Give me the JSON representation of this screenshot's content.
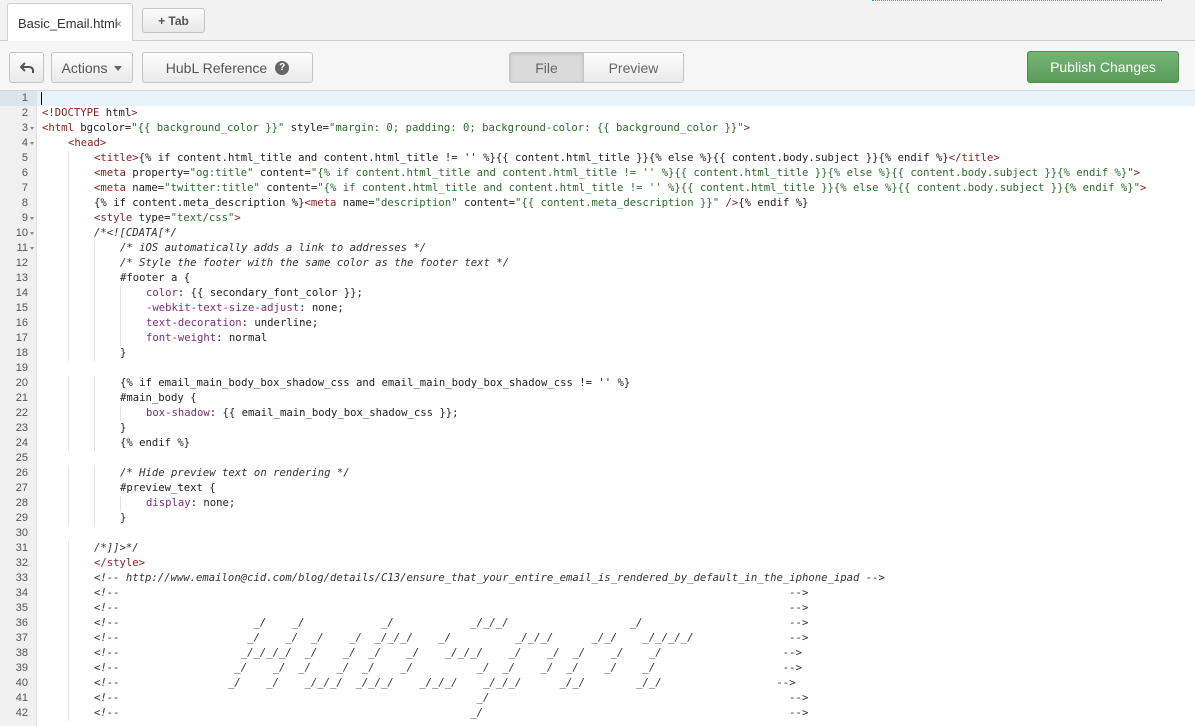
{
  "tabs": {
    "file_tab": {
      "label": "Basic_Email.html",
      "close_glyph": "×"
    },
    "add_tab_label": "+ Tab"
  },
  "toolbar": {
    "back_icon": "undo-arrow-icon",
    "actions_label": "Actions",
    "hubl_label": "HubL Reference",
    "help_glyph": "?",
    "view_modes": {
      "file_label": "File",
      "preview_label": "Preview",
      "selected": "File"
    },
    "publish_label": "Publish Changes"
  },
  "colors": {
    "tag": "#8a2121",
    "attr_name": "#222222",
    "string": "#2d6a2d",
    "comment": "#333333",
    "property": "#7a2d7a",
    "publish_green": "#5fa05f",
    "active_line": "#e8f2fb"
  },
  "editor": {
    "cursor_line": 1,
    "lines": [
      {
        "n": 1,
        "fold": false,
        "indent": 0,
        "text": ""
      },
      {
        "n": 2,
        "fold": false,
        "indent": 0,
        "text": "<!DOCTYPE html>"
      },
      {
        "n": 3,
        "fold": true,
        "indent": 0,
        "text": "<html bgcolor=\"{{ background_color }}\" style=\"margin: 0; padding: 0; background-color: {{ background_color }}\">"
      },
      {
        "n": 4,
        "fold": true,
        "indent": 1,
        "text": "<head>"
      },
      {
        "n": 5,
        "fold": false,
        "indent": 2,
        "text": "<title>{% if content.html_title and content.html_title != '' %}{{ content.html_title }}{% else %}{{ content.body.subject }}{% endif %}</title>"
      },
      {
        "n": 6,
        "fold": false,
        "indent": 2,
        "text": "<meta property=\"og:title\" content=\"{% if content.html_title and content.html_title != '' %}{{ content.html_title }}{% else %}{{ content.body.subject }}{% endif %}\">"
      },
      {
        "n": 7,
        "fold": false,
        "indent": 2,
        "text": "<meta name=\"twitter:title\" content=\"{% if content.html_title and content.html_title != '' %}{{ content.html_title }}{% else %}{{ content.body.subject }}{% endif %}\">"
      },
      {
        "n": 8,
        "fold": false,
        "indent": 2,
        "text": "{% if content.meta_description %}<meta name=\"description\" content=\"{{ content.meta_description }}\" />{% endif %}"
      },
      {
        "n": 9,
        "fold": true,
        "indent": 2,
        "text": "<style type=\"text/css\">"
      },
      {
        "n": 10,
        "fold": true,
        "indent": 2,
        "text": "/*<![CDATA[*/"
      },
      {
        "n": 11,
        "fold": true,
        "indent": 3,
        "text": "/* iOS automatically adds a link to addresses */"
      },
      {
        "n": 12,
        "fold": false,
        "indent": 3,
        "text": "/* Style the footer with the same color as the footer text */"
      },
      {
        "n": 13,
        "fold": false,
        "indent": 3,
        "text": "#footer a {"
      },
      {
        "n": 14,
        "fold": false,
        "indent": 4,
        "text": "color: {{ secondary_font_color }};"
      },
      {
        "n": 15,
        "fold": false,
        "indent": 4,
        "text": "-webkit-text-size-adjust: none;"
      },
      {
        "n": 16,
        "fold": false,
        "indent": 4,
        "text": "text-decoration: underline;"
      },
      {
        "n": 17,
        "fold": false,
        "indent": 4,
        "text": "font-weight: normal"
      },
      {
        "n": 18,
        "fold": false,
        "indent": 3,
        "text": "}"
      },
      {
        "n": 19,
        "fold": false,
        "indent": 0,
        "text": ""
      },
      {
        "n": 20,
        "fold": false,
        "indent": 3,
        "text": "{% if email_main_body_box_shadow_css and email_main_body_box_shadow_css != '' %}"
      },
      {
        "n": 21,
        "fold": false,
        "indent": 3,
        "text": "#main_body {"
      },
      {
        "n": 22,
        "fold": false,
        "indent": 4,
        "text": "box-shadow: {{ email_main_body_box_shadow_css }};"
      },
      {
        "n": 23,
        "fold": false,
        "indent": 3,
        "text": "}"
      },
      {
        "n": 24,
        "fold": false,
        "indent": 3,
        "text": "{% endif %}"
      },
      {
        "n": 25,
        "fold": false,
        "indent": 0,
        "text": ""
      },
      {
        "n": 26,
        "fold": false,
        "indent": 3,
        "text": "/* Hide preview text on rendering */"
      },
      {
        "n": 27,
        "fold": false,
        "indent": 3,
        "text": "#preview_text {"
      },
      {
        "n": 28,
        "fold": false,
        "indent": 4,
        "text": "display: none;"
      },
      {
        "n": 29,
        "fold": false,
        "indent": 3,
        "text": "}"
      },
      {
        "n": 30,
        "fold": false,
        "indent": 0,
        "text": ""
      },
      {
        "n": 31,
        "fold": false,
        "indent": 2,
        "text": "/*]]>*/"
      },
      {
        "n": 32,
        "fold": false,
        "indent": 2,
        "text": "</style>"
      },
      {
        "n": 33,
        "fold": false,
        "indent": 2,
        "text": "<!-- http://www.emailon@cid.com/blog/details/C13/ensure_that_your_entire_email_is_rendered_by_default_in_the_iphone_ipad -->"
      },
      {
        "n": 34,
        "fold": false,
        "indent": 2,
        "text": "<!--                                                                                                         -->"
      },
      {
        "n": 35,
        "fold": false,
        "indent": 2,
        "text": "<!--                                                                                                         -->"
      },
      {
        "n": 36,
        "fold": false,
        "indent": 2,
        "text": "<!--                     _/    _/            _/            _/_/_/                   _/                       -->"
      },
      {
        "n": 37,
        "fold": false,
        "indent": 2,
        "text": "<!--                    _/    _/  _/    _/  _/_/_/    _/          _/_/_/      _/_/    _/_/_/_/               -->"
      },
      {
        "n": 38,
        "fold": false,
        "indent": 2,
        "text": "<!--                   _/_/_/_/  _/    _/  _/    _/    _/_/_/    _/    _/  _/    _/    _/                   -->"
      },
      {
        "n": 39,
        "fold": false,
        "indent": 2,
        "text": "<!--                  _/    _/  _/    _/  _/    _/          _/  _/    _/  _/    _/    _/                    -->"
      },
      {
        "n": 40,
        "fold": false,
        "indent": 2,
        "text": "<!--                 _/    _/    _/_/_/  _/_/_/    _/_/_/    _/_/_/      _/_/        _/_/                  -->"
      },
      {
        "n": 41,
        "fold": false,
        "indent": 2,
        "text": "<!--                                                        _/                                               -->"
      },
      {
        "n": 42,
        "fold": false,
        "indent": 2,
        "text": "<!--                                                       _/                                                -->"
      }
    ]
  }
}
